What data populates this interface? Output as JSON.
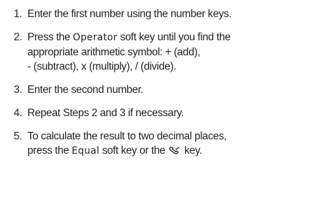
{
  "steps": [
    {
      "number": "1.",
      "text": "Enter the first number using the number keys."
    },
    {
      "number": "2.",
      "before": "Press the ",
      "softkey": "Operator",
      "after_line1": " soft key until you find the",
      "line2": "appropriate arithmetic symbol: + (add),",
      "line3": "- (subtract), x (multiply), / (divide)."
    },
    {
      "number": "3.",
      "text": "Enter the second number."
    },
    {
      "number": "4.",
      "text": "Repeat Steps 2 and 3 if necessary."
    },
    {
      "number": "5.",
      "line1": "To calculate the result to two decimal places,",
      "before": "press the ",
      "softkey": "Equal",
      "middle": " soft key or the ",
      "icon": "send-key-icon",
      "after": " key."
    }
  ]
}
